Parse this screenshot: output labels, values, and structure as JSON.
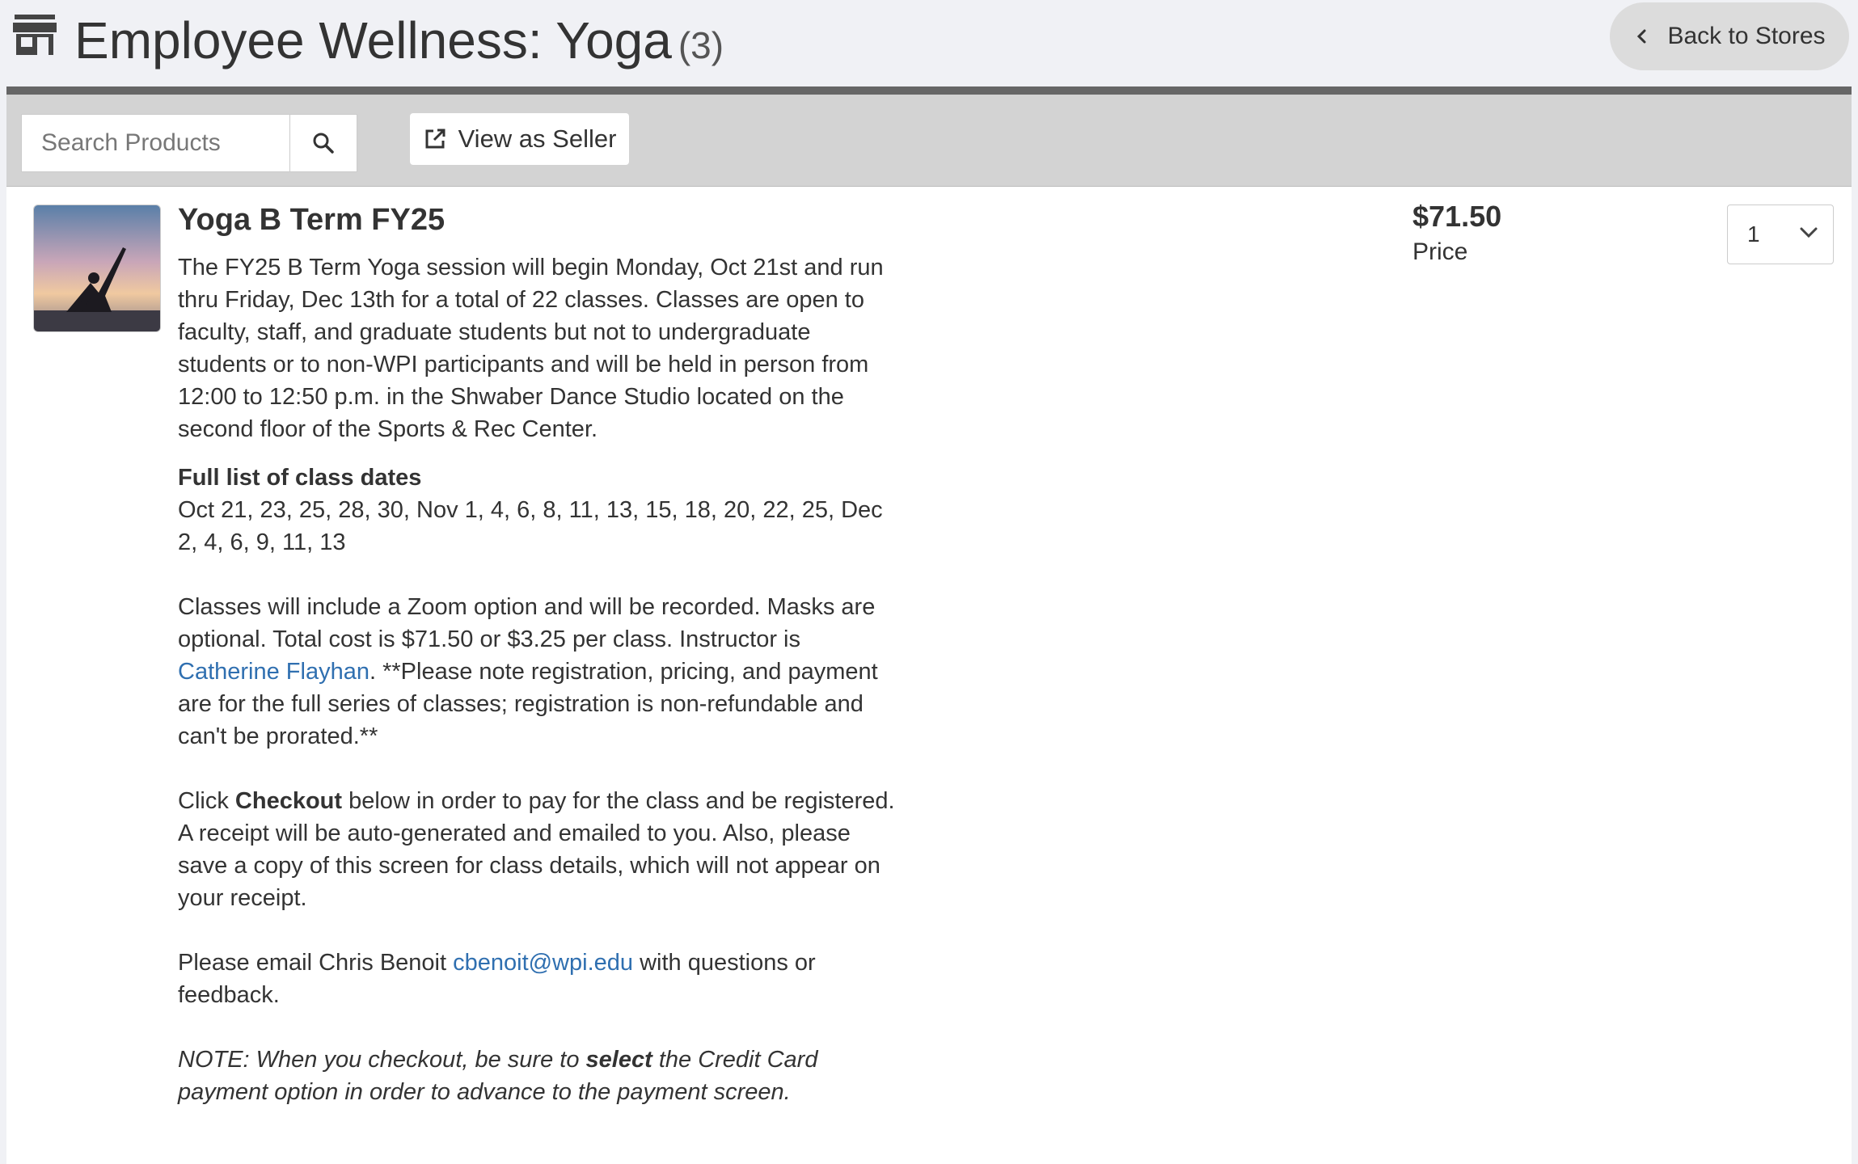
{
  "header": {
    "title": "Employee Wellness: Yoga",
    "count": "(3)",
    "back_label": "Back to Stores"
  },
  "toolbar": {
    "search_placeholder": "Search Products",
    "view_seller_label": "View as Seller"
  },
  "product": {
    "title": "Yoga B Term FY25",
    "price": "$71.50",
    "price_label": "Price",
    "quantity": "1",
    "description": {
      "intro": "The FY25 B Term Yoga session will begin Monday, Oct 21st and run thru Friday, Dec 13th for a total of 22 classes. Classes are open to faculty, staff, and graduate students but not to undergraduate students or to non-WPI participants and will be held in person from 12:00 to 12:50 p.m. in the Shwaber Dance Studio located on the second floor of the Sports & Rec Center.",
      "dates_heading": "Full list of class dates",
      "dates": "Oct 21, 23, 25, 28, 30, Nov 1, 4, 6, 8, 11, 13, 15, 18, 20, 22, 25, Dec 2, 4, 6, 9, 11, 13",
      "zoom_text": "Classes will include a Zoom option and will be recorded. Masks are optional. Total cost is $71.50 or $3.25 per class. Instructor is",
      "instructor_link": "Catherine Flayhan",
      "zoom_text_after": ". **Please note registration, pricing, and payment are for the full series of classes; registration is non-refundable and can't be prorated.**",
      "checkout_before": "Click",
      "checkout_bold": "Checkout",
      "checkout_after": "below in order to pay for the class and be registered. A receipt will be auto-generated and emailed to you. Also, please save a copy of this screen for class details, which will not appear on your receipt.",
      "email_before": "Please email Chris Benoit",
      "email_link": "cbenoit@wpi.edu",
      "email_after": "with questions or feedback.",
      "note_before": "NOTE: When you checkout, be sure to",
      "note_bold": "select",
      "note_after": "the Credit Card payment option in order to advance to the payment screen."
    }
  }
}
